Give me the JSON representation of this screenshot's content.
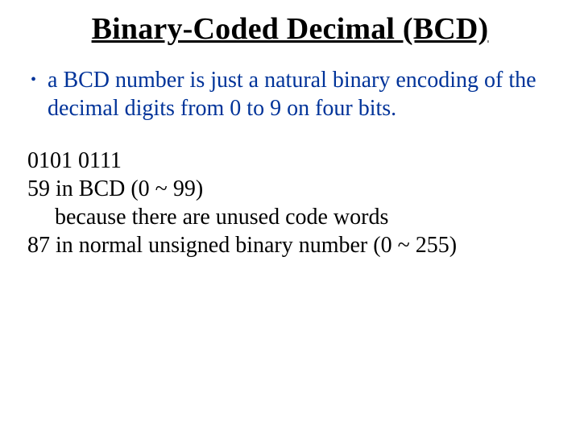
{
  "title": "Binary-Coded Decimal (BCD)",
  "bullet": {
    "text": "a BCD number is just a natural binary encoding of the decimal digits from 0 to 9 on four bits."
  },
  "body": {
    "line1": "0101 0111",
    "line2": "59 in BCD (0 ~ 99)",
    "line3": "because there are unused code words",
    "line4": "87 in normal unsigned binary number (0 ~ 255)"
  }
}
